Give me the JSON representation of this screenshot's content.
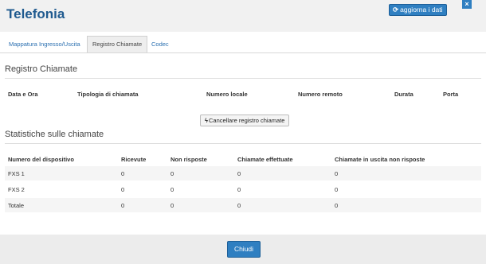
{
  "header": {
    "title": "Telefonia",
    "refresh_icon": "refresh-icon",
    "refresh_label": "aggiorna i dati",
    "close_label": "×"
  },
  "tabs": [
    {
      "label": "Mappatura Ingresso/Uscita",
      "active": false
    },
    {
      "label": "Registro Chiamate",
      "active": true
    },
    {
      "label": "Codec",
      "active": false
    }
  ],
  "call_log": {
    "title": "Registro Chiamate",
    "columns": [
      "Data e Ora",
      "Tipologia di chiamata",
      "Numero locale",
      "Numero remoto",
      "Durata",
      "Porta"
    ],
    "clear_icon": "bolt-icon",
    "clear_label": "Cancellare registro chiamate"
  },
  "stats": {
    "title": "Statistiche sulle chiamate",
    "columns": [
      "Numero del dispositivo",
      "Ricevute",
      "Non risposte",
      "Chiamate effettuate",
      "Chiamate in uscita non risposte"
    ],
    "rows": [
      [
        "FXS 1",
        "0",
        "0",
        "0",
        "0"
      ],
      [
        "FXS 2",
        "0",
        "0",
        "0",
        "0"
      ],
      [
        "Totale",
        "0",
        "0",
        "0",
        "0"
      ]
    ]
  },
  "footer": {
    "close_label": "Chiudi"
  },
  "colors": {
    "accent": "#2f7fc1",
    "title": "#1f5a8f"
  }
}
